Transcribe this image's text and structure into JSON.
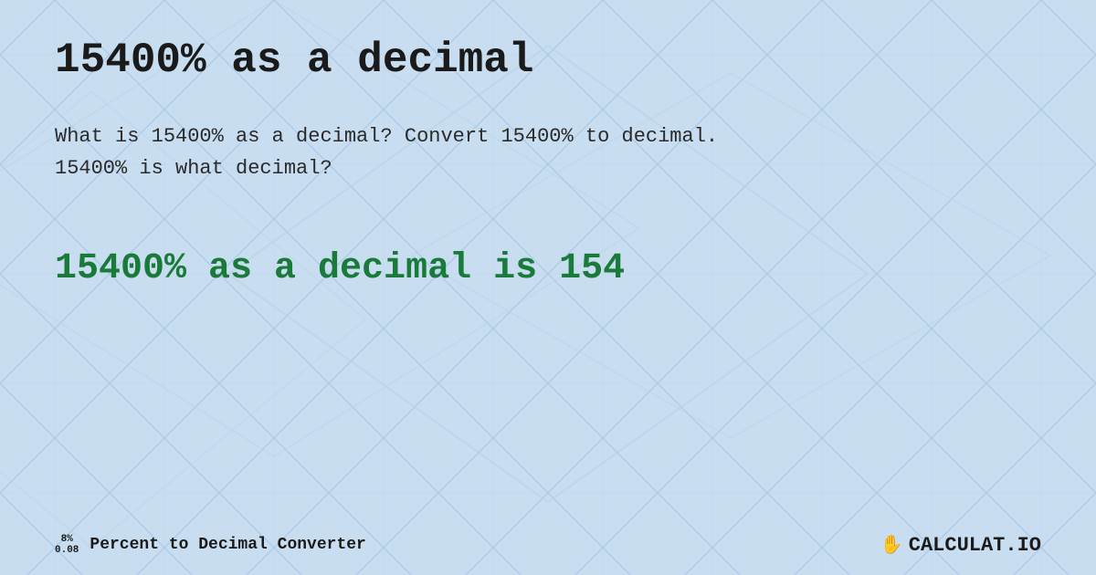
{
  "page": {
    "title": "15400% as a decimal",
    "background_color": "#c8ddf0",
    "accent_color": "#1a7a3a"
  },
  "header": {
    "title": "15400% as a decimal"
  },
  "description": {
    "line1": "What is 15400% as a decimal? Convert 15400% to decimal.",
    "line2": "15400% is what decimal?"
  },
  "result": {
    "text": "15400% as a decimal is 154"
  },
  "footer": {
    "percent_top": "8%",
    "percent_bottom": "0.08",
    "label": "Percent to Decimal Converter",
    "logo_text": "CALCULAT.IO"
  }
}
